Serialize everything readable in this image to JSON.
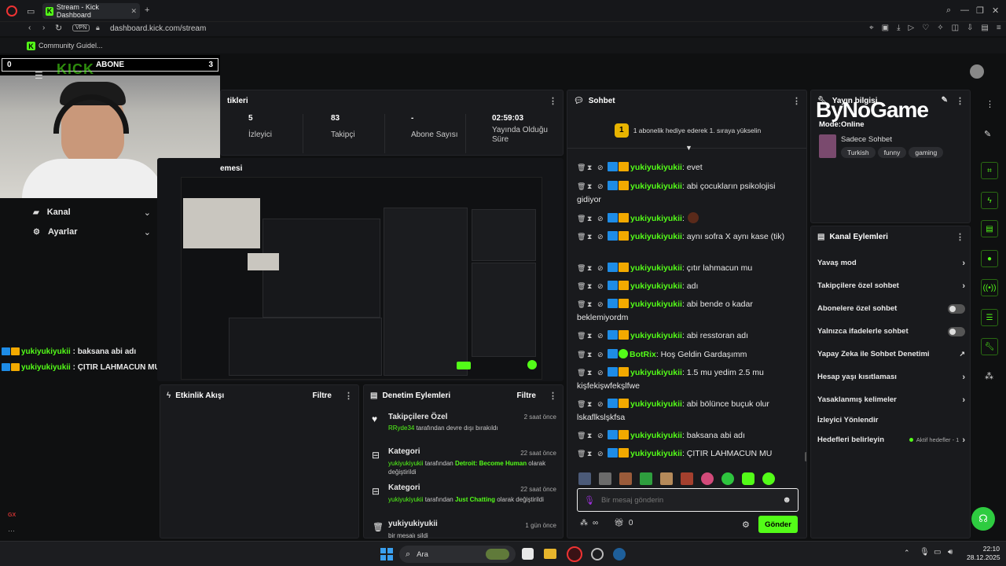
{
  "browser": {
    "tab_title": "Stream - Kick Dashboard",
    "url": "dashboard.kick.com/stream",
    "vpn": "VPN",
    "bookmark": "Community Guidel..."
  },
  "overlay": {
    "abone_left": "0",
    "abone_label": "ABONE",
    "abone_right": "3",
    "logo_word": "KICK",
    "bynogame": "ByNoGame"
  },
  "sidebar": {
    "items": [
      {
        "label": "Kanal"
      },
      {
        "label": "Ayarlar"
      }
    ],
    "gx": "GX"
  },
  "overlay_chat": [
    {
      "user": "yukiyukiyukii",
      "text": " : baksana abi adı"
    },
    {
      "user": "yukiyukiyukii",
      "text": " : ÇITIR LAHMACUN MU"
    }
  ],
  "stats": {
    "title_fragment": "tikleri",
    "items": [
      {
        "value": "5",
        "label": "İzleyici"
      },
      {
        "value": "83",
        "label": "Takipçi"
      },
      {
        "value": "-",
        "label": "Abone Sayısı"
      },
      {
        "value": "02:59:03",
        "label": "Yayında Olduğu Süre"
      }
    ]
  },
  "preview": {
    "title_fragment": "emesi"
  },
  "events": {
    "title": "Etkinlik Akışı",
    "filter": "Filtre"
  },
  "moderation": {
    "title": "Denetim Eylemleri",
    "filter": "Filtre",
    "items": [
      {
        "title": "Takipçilere Özel",
        "time": "2 saat önce",
        "actor": "RRyde34",
        "text": " tarafından devre dışı bırakıldı",
        "icon": "heart-icon"
      },
      {
        "title": "Kategori",
        "time": "22 saat önce",
        "actor": "yukiyukiyukii",
        "mid": " tarafından ",
        "target": "Detroit: Become Human",
        "end": " olarak değiştirildi",
        "icon": "category-icon"
      },
      {
        "title": "Kategori",
        "time": "22 saat önce",
        "actor": "yukiyukiyukii",
        "mid": " tarafından ",
        "target": "Just Chatting",
        "end": " olarak değiştirildi",
        "icon": "category-icon"
      },
      {
        "title": "yukiyukiyukii",
        "time": "1 gün önce",
        "text2": "bir mesajı sildi",
        "icon": "trash-icon"
      }
    ]
  },
  "chat": {
    "title": "Sohbet",
    "goal_rank": "1",
    "goal_text": "1 abonelik hediye ederek 1. sıraya yükselin",
    "messages": [
      {
        "user": "yukiyukiyukii",
        "text": ": evet"
      },
      {
        "user": "yukiyukiyukii",
        "text": ": abi çocukların psikolojisi gidiyor"
      },
      {
        "user": "yukiyukiyukii",
        "text": ":"
      },
      {
        "user": "yukiyukiyukii",
        "text": ": aynı sofra X aynı kase (tik)"
      },
      {
        "user": "yukiyukiyukii",
        "text": ": çıtır lahmacun mu"
      },
      {
        "user": "yukiyukiyukii",
        "text": ": adı"
      },
      {
        "user": "yukiyukiyukii",
        "text": ": abi bende o kadar beklemiyordm"
      },
      {
        "user": "yukiyukiyukii",
        "text": ": abi resstoran adı"
      },
      {
        "user": "BotRix",
        "text": ": Hoş Geldin Gardaşımm",
        "bot": true
      },
      {
        "user": "yukiyukiyukii",
        "text": ": 1.5 mu yedim 2.5 mu kişfekişwfekşlfwe"
      },
      {
        "user": "yukiyukiyukii",
        "text": ": abi bölünce buçuk olur lskaflkslşkfsa"
      },
      {
        "user": "yukiyukiyukii",
        "text": ": baksana abi adı"
      },
      {
        "user": "yukiyukiyukii",
        "text": ": ÇITIR LAHMACUN MU"
      }
    ],
    "input_placeholder": "Bir mesaj gönderin",
    "count_infinity": "∞",
    "count_zero": "0",
    "send_label": "Gönder"
  },
  "stream_info": {
    "title": "Yayın bilgisi",
    "mode": "Mode:Online",
    "category": "Sadece Sohbet",
    "tags": [
      "Turkish",
      "funny",
      "gaming"
    ]
  },
  "channel_actions": {
    "title": "Kanal Eylemleri",
    "items": [
      {
        "label": "Yavaş mod",
        "control": "chevron"
      },
      {
        "label": "Takipçilere özel sohbet",
        "control": "chevron"
      },
      {
        "label": "Abonelere özel sohbet",
        "control": "toggle"
      },
      {
        "label": "Yalnızca ifadelerle sohbet",
        "control": "toggle"
      },
      {
        "label": "Yapay Zeka ile Sohbet Denetimi",
        "control": "external"
      },
      {
        "label": "Hesap yaşı kısıtlaması",
        "control": "chevron"
      },
      {
        "label": "Yasaklanmış kelimeler",
        "control": "chevron"
      },
      {
        "label": "İzleyici Yönlendir",
        "control": "none"
      },
      {
        "label": "Hedefleri belirleyin",
        "control": "chevron",
        "extra": "Aktif hedefler - 1"
      }
    ]
  },
  "taskbar": {
    "search": "Ara",
    "time": "22:10",
    "date": "28.12.2025"
  },
  "colors": {
    "accent": "#53fc18",
    "panel": "#191a1d",
    "background": "#0f1011"
  }
}
